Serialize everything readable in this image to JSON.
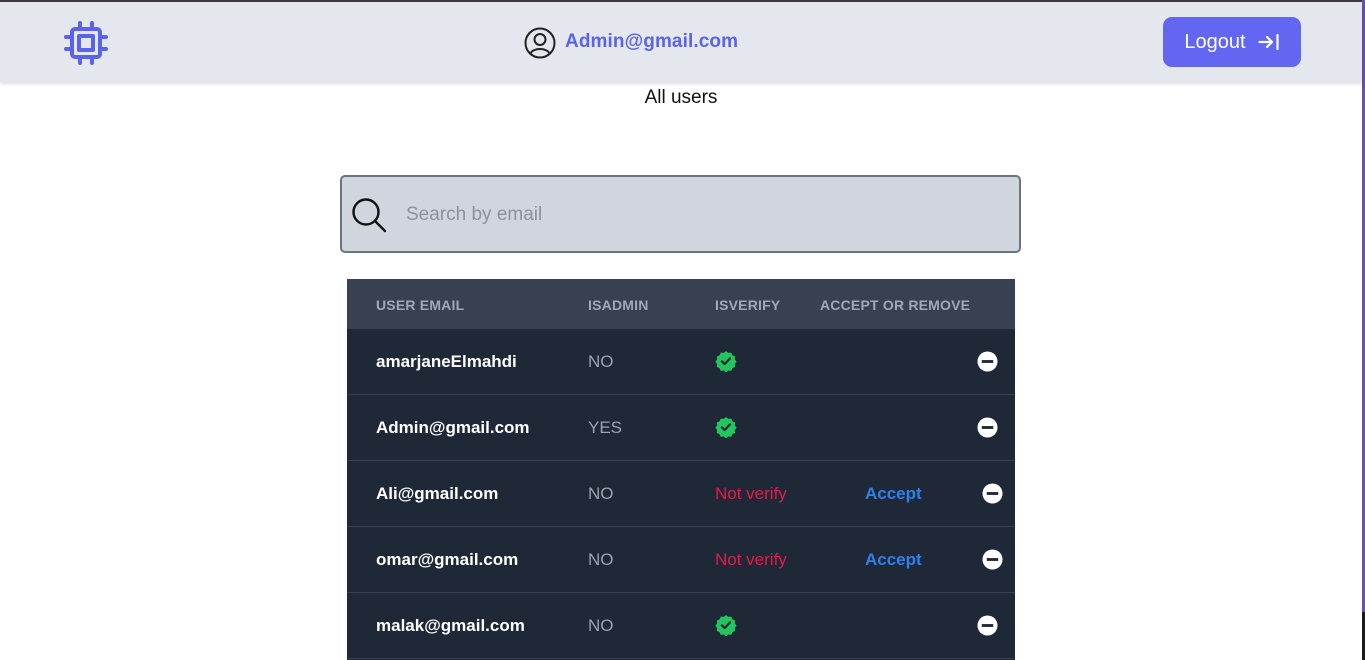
{
  "header": {
    "user_email": "Admin@gmail.com",
    "logout_label": "Logout"
  },
  "page": {
    "title": "All users"
  },
  "search": {
    "placeholder": "Search by email",
    "value": ""
  },
  "table": {
    "columns": [
      "USER EMAIL",
      "ISADMIN",
      "ISVERIFY",
      "ACCEPT OR REMOVE"
    ],
    "rows": [
      {
        "email": "amarjaneElmahdi",
        "is_admin": "NO",
        "verified": true
      },
      {
        "email": "Admin@gmail.com",
        "is_admin": "YES",
        "verified": true
      },
      {
        "email": "Ali@gmail.com",
        "is_admin": "NO",
        "verified": false,
        "verify_text": "Not verify",
        "accept_label": "Accept"
      },
      {
        "email": "omar@gmail.com",
        "is_admin": "NO",
        "verified": false,
        "verify_text": "Not verify",
        "accept_label": "Accept"
      },
      {
        "email": "malak@gmail.com",
        "is_admin": "NO",
        "verified": true
      }
    ]
  },
  "colors": {
    "accent": "#6366f1",
    "header_bg": "#e4e7ed",
    "table_bg": "#1e2837",
    "table_head_bg": "#374151",
    "verified_green": "#22c55e",
    "not_verify_red": "#e11d48",
    "accept_blue": "#2f80ed"
  },
  "icons": {
    "logo": "cpu-chip-icon",
    "user": "user-circle-icon",
    "logout": "arrow-right-to-bar-icon",
    "search": "magnifier-icon",
    "verified": "verified-badge-icon",
    "remove": "minus-circle-icon"
  }
}
